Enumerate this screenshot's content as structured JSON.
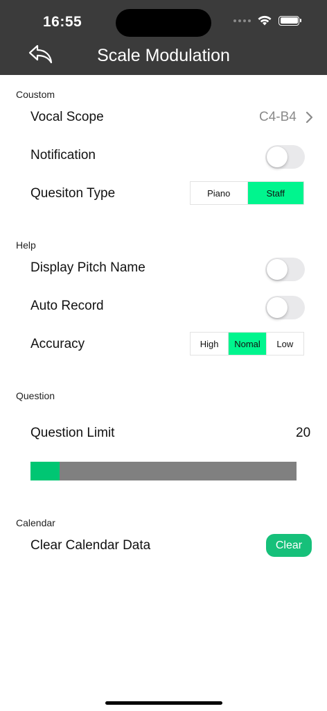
{
  "status_bar": {
    "time": "16:55"
  },
  "nav": {
    "title": "Scale Modulation"
  },
  "sections": {
    "custom": {
      "header": "Coustom",
      "vocal_scope": {
        "label": "Vocal Scope",
        "value": "C4-B4"
      },
      "notification": {
        "label": "Notification",
        "on": false
      },
      "question_type": {
        "label": "Quesiton Type",
        "options": [
          "Piano",
          "Staff"
        ],
        "selected": "Staff"
      }
    },
    "help": {
      "header": "Help",
      "display_pitch_name": {
        "label": "Display Pitch Name",
        "on": false
      },
      "auto_record": {
        "label": "Auto Record",
        "on": false
      },
      "accuracy": {
        "label": "Accuracy",
        "options": [
          "High",
          "Nomal",
          "Low"
        ],
        "selected": "Nomal"
      }
    },
    "question": {
      "header": "Question",
      "question_limit": {
        "label": "Question Limit",
        "value": "20",
        "slider_fraction": 0.11
      }
    },
    "calendar": {
      "header": "Calendar",
      "clear_calendar": {
        "label": "Clear Calendar Data",
        "button": "Clear"
      }
    }
  },
  "colors": {
    "nav_bg": "#3b3b3b",
    "segment_active": "#00f58e",
    "slider_fill": "#00c673",
    "slider_track": "#808080",
    "clear_button": "#16c07a"
  }
}
